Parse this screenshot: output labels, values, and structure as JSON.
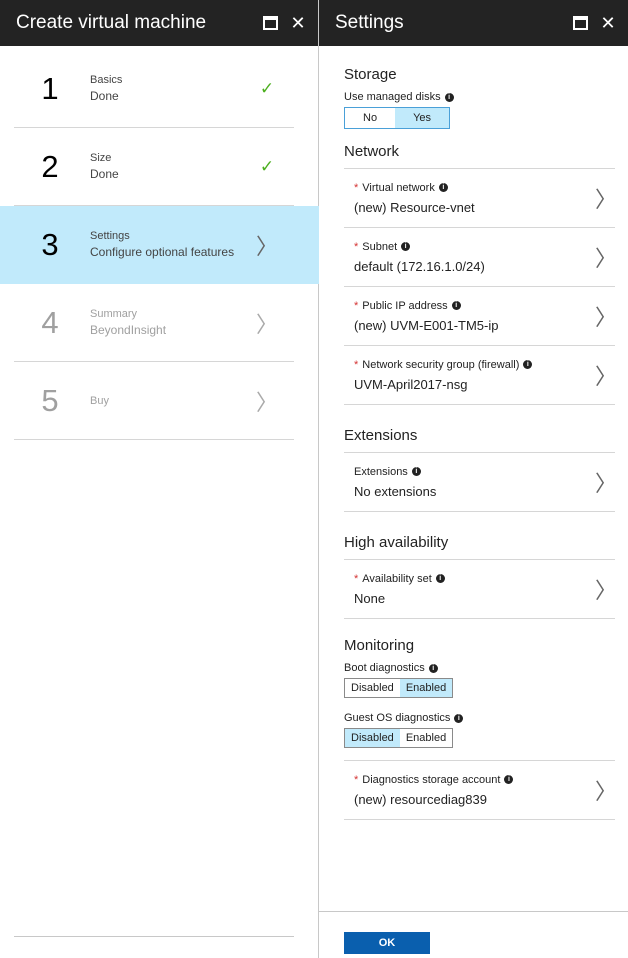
{
  "left_blade": {
    "title": "Create virtual machine",
    "steps": [
      {
        "num": "1",
        "title": "Basics",
        "sub": "Done",
        "state": "done"
      },
      {
        "num": "2",
        "title": "Size",
        "sub": "Done",
        "state": "done"
      },
      {
        "num": "3",
        "title": "Settings",
        "sub": "Configure optional features",
        "state": "active"
      },
      {
        "num": "4",
        "title": "Summary",
        "sub": "BeyondInsight",
        "state": "disabled"
      },
      {
        "num": "5",
        "title": "Buy",
        "sub": "",
        "state": "disabled"
      }
    ],
    "icons": {
      "check": "✓",
      "chevron": "〉"
    }
  },
  "right_blade": {
    "title": "Settings",
    "storage": {
      "title": "Storage",
      "managed_label": "Use managed disks",
      "options": [
        "No",
        "Yes"
      ],
      "selected": "Yes"
    },
    "network": {
      "title": "Network",
      "virtual_network": {
        "label": "Virtual network",
        "value": "(new) Resource-vnet"
      },
      "subnet": {
        "label": "Subnet",
        "value": "default (172.16.1.0/24)"
      },
      "public_ip": {
        "label": "Public IP address",
        "value": "(new) UVM-E001-TM5-ip"
      },
      "nsg": {
        "label": "Network security group (firewall)",
        "value": "UVM-April2017-nsg"
      }
    },
    "extensions": {
      "title": "Extensions",
      "label": "Extensions",
      "value": "No extensions"
    },
    "availability": {
      "title": "High availability",
      "label": "Availability set",
      "value": "None"
    },
    "monitoring": {
      "title": "Monitoring",
      "boot_label": "Boot diagnostics",
      "boot_options": [
        "Disabled",
        "Enabled"
      ],
      "boot_selected": "Enabled",
      "guest_label": "Guest OS diagnostics",
      "guest_options": [
        "Disabled",
        "Enabled"
      ],
      "guest_selected": "Disabled",
      "storage_label": "Diagnostics storage account",
      "storage_value": "(new) resourcediag839"
    },
    "ok_label": "OK"
  },
  "symbols": {
    "required": "*",
    "info": "i",
    "close": "✕"
  },
  "colors": {
    "header_bg": "#232323",
    "selected_bg": "#c1eafb",
    "ok_bg": "#0a5fae",
    "check": "#4caf1f",
    "required": "#d43333"
  }
}
